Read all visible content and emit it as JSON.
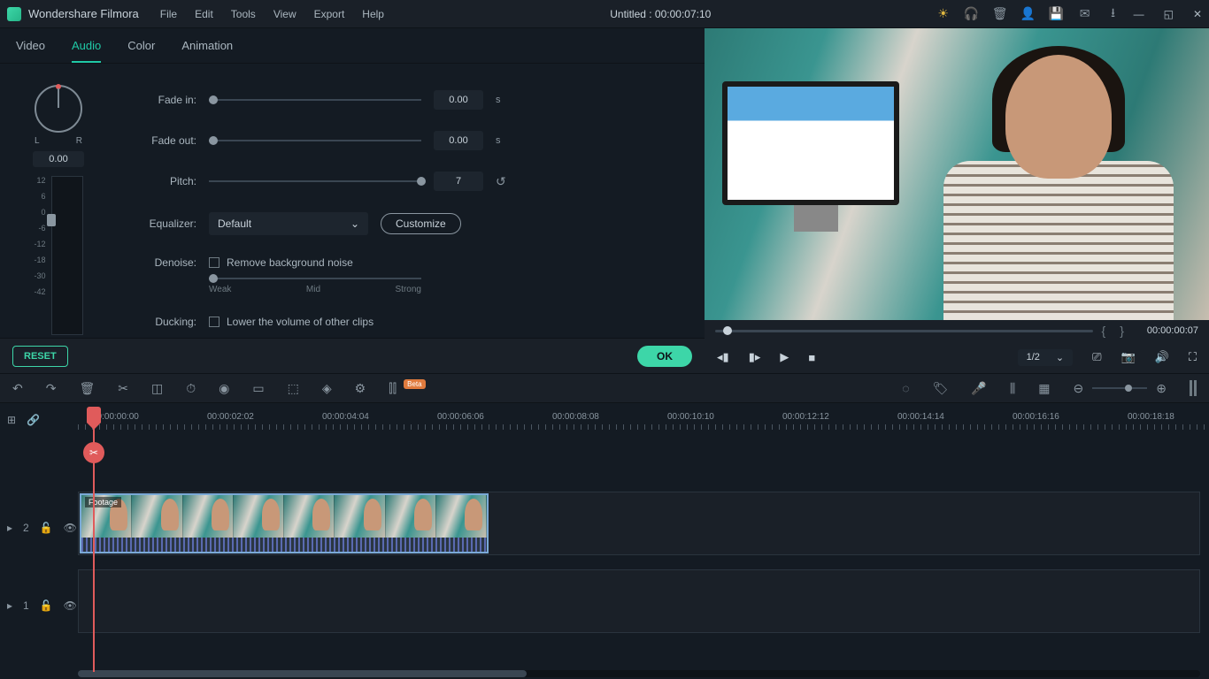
{
  "app": {
    "name": "Wondershare Filmora",
    "doc_title": "Untitled : 00:00:07:10"
  },
  "menu": {
    "file": "File",
    "edit": "Edit",
    "tools": "Tools",
    "view": "View",
    "export": "Export",
    "help": "Help"
  },
  "tabs": {
    "video": "Video",
    "audio": "Audio",
    "color": "Color",
    "animation": "Animation"
  },
  "knob": {
    "l": "L",
    "r": "R",
    "value": "0.00"
  },
  "db": [
    "12",
    "6",
    "0",
    "-6",
    "-12",
    "-18",
    "-30",
    "-42"
  ],
  "audio": {
    "fade_in": {
      "label": "Fade in:",
      "value": "0.00",
      "unit": "s"
    },
    "fade_out": {
      "label": "Fade out:",
      "value": "0.00",
      "unit": "s"
    },
    "pitch": {
      "label": "Pitch:",
      "value": "7"
    },
    "equalizer": {
      "label": "Equalizer:",
      "value": "Default",
      "customize": "Customize"
    },
    "denoise": {
      "label": "Denoise:",
      "check": "Remove background noise",
      "weak": "Weak",
      "mid": "Mid",
      "strong": "Strong"
    },
    "ducking": {
      "label": "Ducking:",
      "check": "Lower the volume of other clips"
    }
  },
  "buttons": {
    "reset": "RESET",
    "ok": "OK"
  },
  "preview": {
    "time": "00:00:00:07",
    "ratio": "1/2"
  },
  "toolbar": {
    "badge": "Beta"
  },
  "ruler": [
    "00:00:00:00",
    "00:00:02:02",
    "00:00:04:04",
    "00:00:06:06",
    "00:00:08:08",
    "00:00:10:10",
    "00:00:12:12",
    "00:00:14:14",
    "00:00:16:16",
    "00:00:18:18"
  ],
  "clip": {
    "label": "Footage"
  },
  "track": {
    "v2": "2",
    "v1": "1"
  }
}
